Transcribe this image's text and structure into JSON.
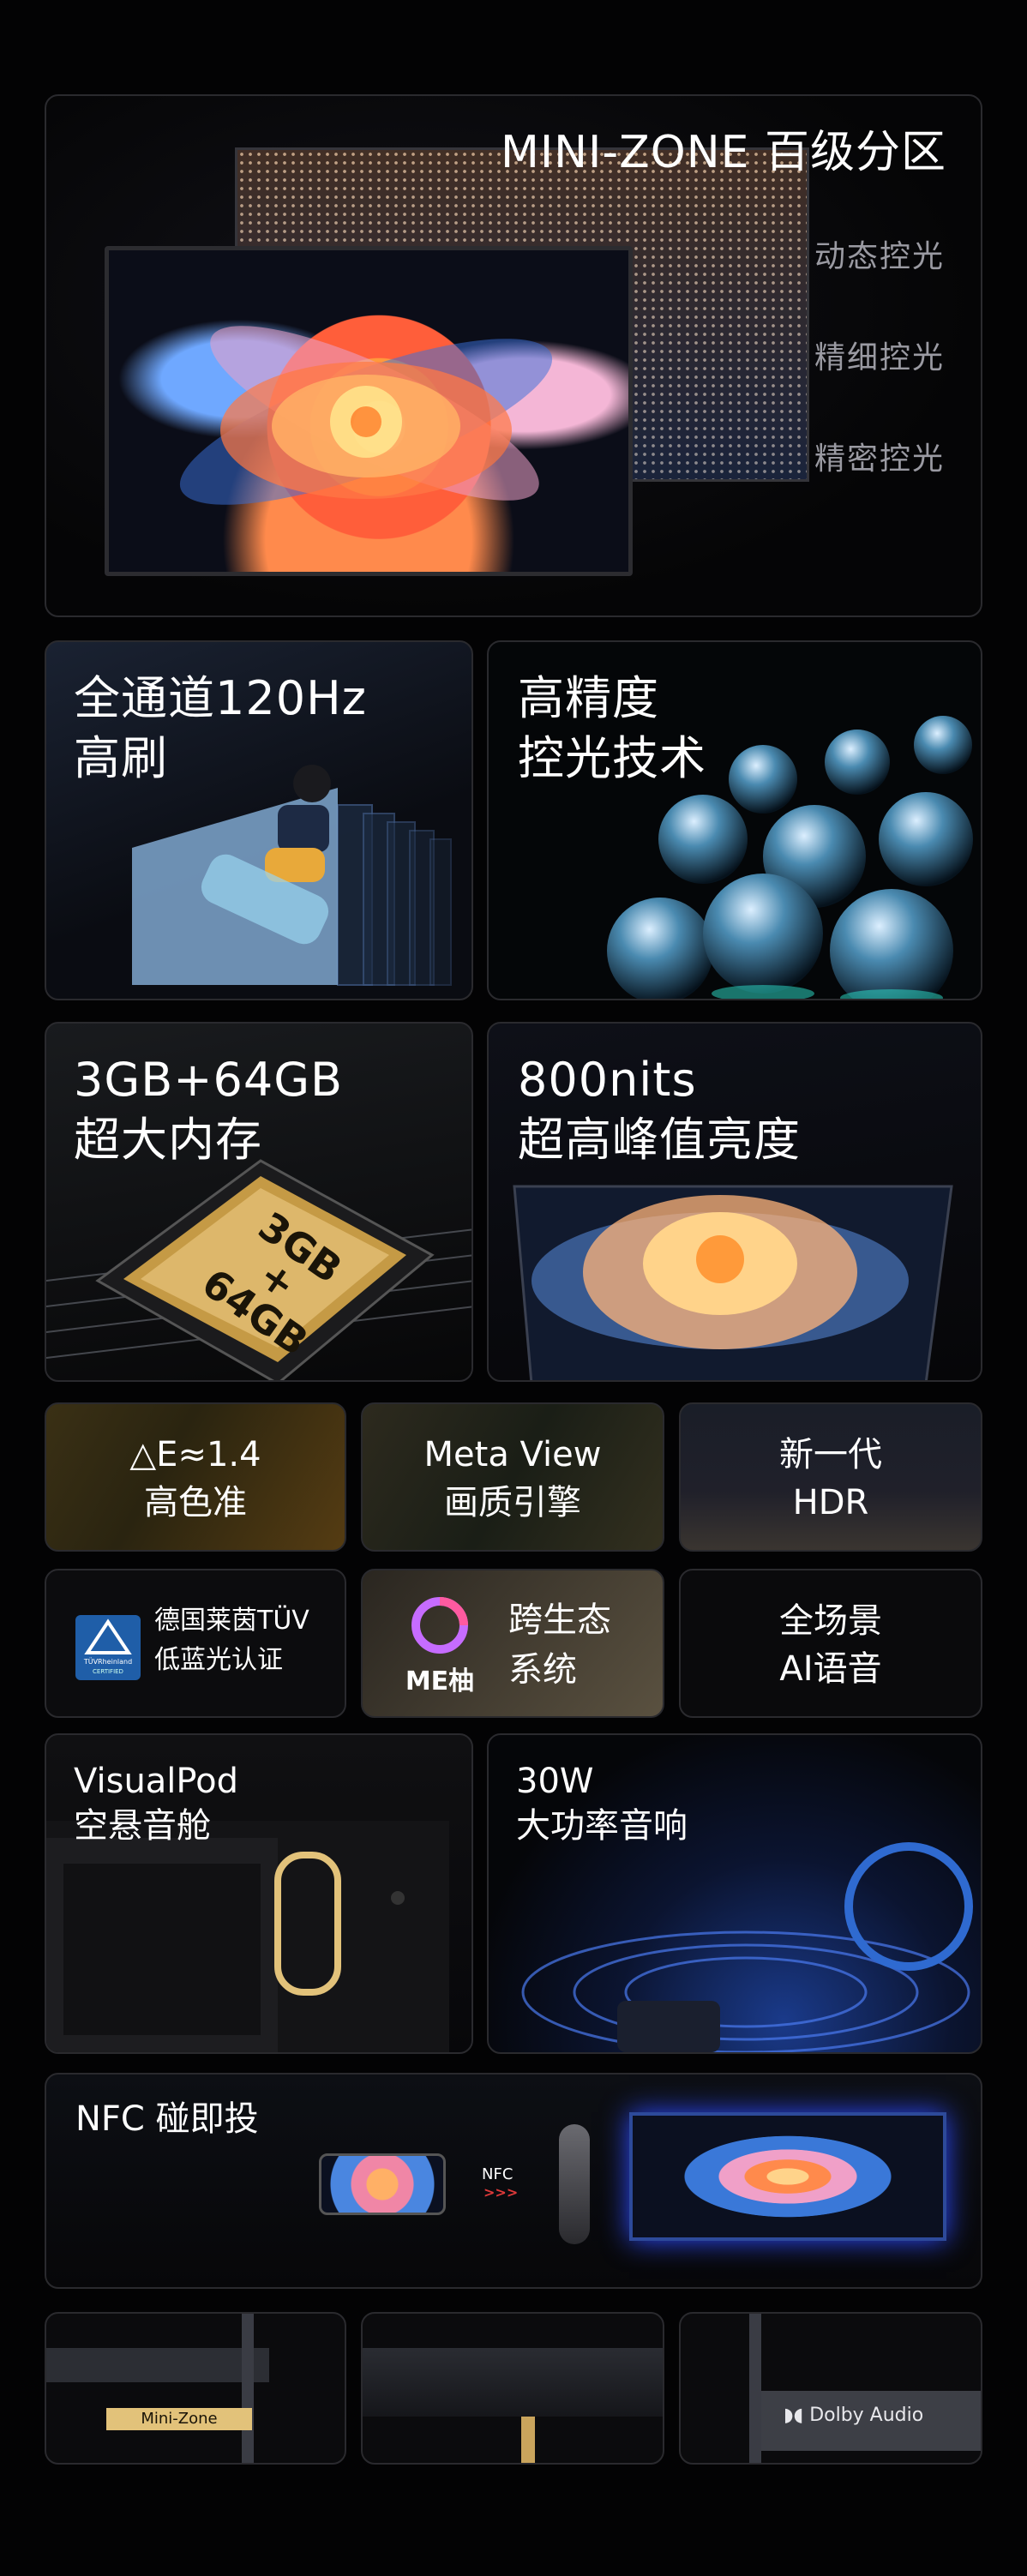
{
  "mini_zone": {
    "title": "MINI-ZONE 百级分区",
    "features": [
      "动态控光",
      "精细控光",
      "精密控光"
    ]
  },
  "refresh": {
    "line1": "全通道120Hz",
    "line2": "高刷"
  },
  "precision": {
    "line1": "高精度",
    "line2": "控光技术"
  },
  "memory": {
    "line1": "3GB+64GB",
    "line2": "超大内存",
    "chip_top": "3GB",
    "chip_plus": "+",
    "chip_bottom": "64GB"
  },
  "brightness": {
    "line1": "800nits",
    "line2": "超高峰值亮度"
  },
  "color": {
    "line1": "△E≈1.4",
    "line2": "高色准"
  },
  "metaview": {
    "line1": "Meta View",
    "line2": "画质引擎"
  },
  "hdr": {
    "line1": "新一代",
    "line2": "HDR"
  },
  "tuv": {
    "line1": "德国莱茵TÜV",
    "line2": "低蓝光认证",
    "badge_text": "TÜVRheinland",
    "badge_sub": "CERTIFIED"
  },
  "ecosystem": {
    "line1": "跨生态",
    "line2": "系统",
    "logo": "ME柚"
  },
  "voice": {
    "line1": "全场景",
    "line2": "AI语音"
  },
  "visualpod": {
    "line1": "VisualPod",
    "line2": "空悬音舱"
  },
  "audio": {
    "line1": "30W",
    "line2": "大功率音响"
  },
  "nfc": {
    "title": "NFC 碰即投",
    "label": "NFC",
    "arrows": ">>>"
  },
  "details": {
    "minizone_label": "Mini-Zone",
    "dolby_label": "Dolby Audio"
  },
  "colors": {
    "background": "#030304",
    "card_border": "#2a2a2e",
    "accent_gold": "#e2c27a",
    "nfc_red": "#e03a3a"
  }
}
